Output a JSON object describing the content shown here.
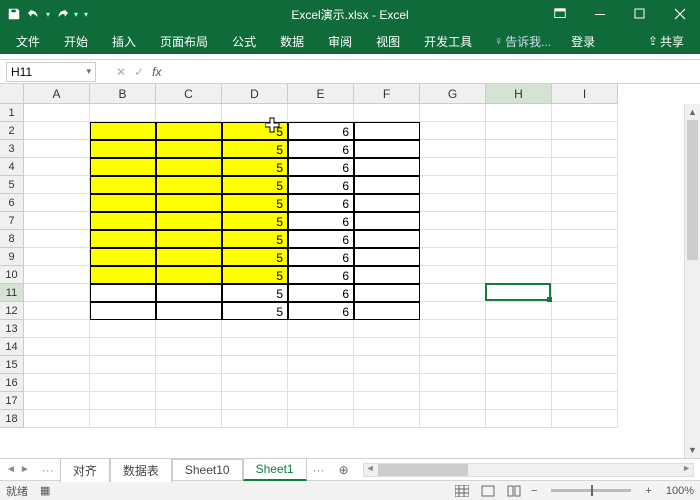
{
  "title": "Excel演示.xlsx - Excel",
  "qat": {
    "save": "save-icon",
    "undo": "undo-icon",
    "redo": "redo-icon"
  },
  "window": {
    "ribbon_opts": "ribbon-opts-icon",
    "min": "min-icon",
    "max": "max-icon",
    "close": "close-icon"
  },
  "tabs": {
    "file": "文件",
    "home": "开始",
    "insert": "插入",
    "layout": "页面布局",
    "formulas": "公式",
    "data": "数据",
    "review": "审阅",
    "view": "视图",
    "dev": "开发工具",
    "tellme": "告诉我...",
    "login": "登录",
    "share": "共享"
  },
  "namebox": "H11",
  "fx_label": "fx",
  "columns": [
    "A",
    "B",
    "C",
    "D",
    "E",
    "F",
    "G",
    "H",
    "I"
  ],
  "rows": [
    "1",
    "2",
    "3",
    "4",
    "5",
    "6",
    "7",
    "8",
    "9",
    "10",
    "11",
    "12",
    "13",
    "14",
    "15",
    "16",
    "17",
    "18"
  ],
  "active": {
    "col": "H",
    "row": "11"
  },
  "table": {
    "yellow_rows": [
      2,
      3,
      4,
      5,
      6,
      7,
      8,
      9,
      10
    ],
    "white_rows": [
      11,
      12
    ],
    "d_value": "5",
    "e_value": "6"
  },
  "sheets": {
    "nav_first": "◄",
    "nav_last": "►",
    "s1": "对齐",
    "s2": "数据表",
    "s3": "Sheet10",
    "s4": "Sheet1",
    "add": "⊕",
    "dots": "···"
  },
  "status": {
    "ready": "就绪",
    "rec": "▦",
    "zoom": "100%",
    "minus": "−",
    "plus": "+"
  },
  "colors": {
    "brand": "#0f6b3a",
    "accent": "#107c41",
    "highlight": "#ffff00"
  }
}
